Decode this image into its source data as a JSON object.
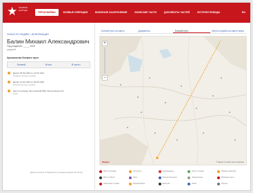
{
  "header": {
    "logo_text": "ПАМЯТЬ НАРОДА",
    "nav": [
      {
        "label": "ГЕРОИ ВОЙНЫ",
        "active": true
      },
      {
        "label": "БОЕВЫЕ ОПЕРАЦИИ",
        "active": false
      },
      {
        "label": "ВОИНСКИЕ ЗАХОРОНЕНИЯ",
        "active": false
      },
      {
        "label": "ВОИНСКИЕ ЧАСТИ",
        "active": false
      },
      {
        "label": "ДОКУМЕНТЫ ЧАСТЕЙ",
        "active": false
      },
      {
        "label": "ИСТОРИЯ ПОБЕДЫ",
        "active": false
      }
    ],
    "lang": "RU",
    "accent": "#c8161d"
  },
  "person": {
    "breadcrumb": "ПОИСК ПО ЛЮДЯМ > ИНФОРМАЦИЯ",
    "name": "Балин Михаил Александрович",
    "birth": "Год рождения: __.__.1925",
    "rank": "рядовой",
    "section_title": "Хронология боевого пути",
    "tabs": [
      "Боевой",
      "Итого",
      "В части"
    ],
    "events": [
      {
        "line1": "Дата/с 05.09.1943 по 14.01.1944",
        "line2": "Первый период службы"
      },
      {
        "line1": "Дата/с 14.01.1944 по 09.05.1945",
        "line2": "Второй период службы"
      },
      {
        "line1": "Место призыва: Молотовский РВК, Молотовская обл.",
        "line2": "1943"
      }
    ]
  },
  "map": {
    "tabs": [
      {
        "label": "Боевой путь на карте",
        "active": false
      },
      {
        "label": "Документы",
        "active": false
      },
      {
        "label": "Боевой путь",
        "active": true
      },
      {
        "label": "Места службы на карте мира",
        "active": false
      }
    ],
    "zoom_in": "+",
    "zoom_out": "−",
    "copyright": "© Яндекс Условия использования",
    "logo": "Яндекс",
    "legend": [
      [
        {
          "label": "Место призыва",
          "color": "#c8161d"
        },
        {
          "label": "Госпиталь",
          "color": "#f1a02a"
        },
        {
          "label": "Награждение",
          "color": "#e0342c"
        },
        {
          "label": "Место службы",
          "color": "#5aa35a"
        },
        {
          "label": "Боевые действия",
          "color": "#f1a02a"
        }
      ],
      [
        {
          "label": "Место гибели",
          "color": "#333333"
        },
        {
          "label": "Плен",
          "color": "#8a5ab0"
        },
        {
          "label": "Пропал без вести",
          "color": "#3e67b1"
        },
        {
          "label": "Захоронение",
          "color": "#999999"
        },
        {
          "label": "Воинская часть",
          "color": "#c8161d"
        }
      ],
      [
        {
          "label": "Окончание службы",
          "color": "#c8161d"
        },
        {
          "label": "Перемещение",
          "color": "#f1a02a"
        },
        {
          "label": "Выбытие",
          "color": "#333333"
        },
        {
          "label": "Штаб",
          "color": "#3e67b1"
        },
        {
          "label": "Прочее",
          "color": "#777777"
        }
      ]
    ],
    "footer_note": "Данные на карте отображаются по данным документов частей"
  }
}
